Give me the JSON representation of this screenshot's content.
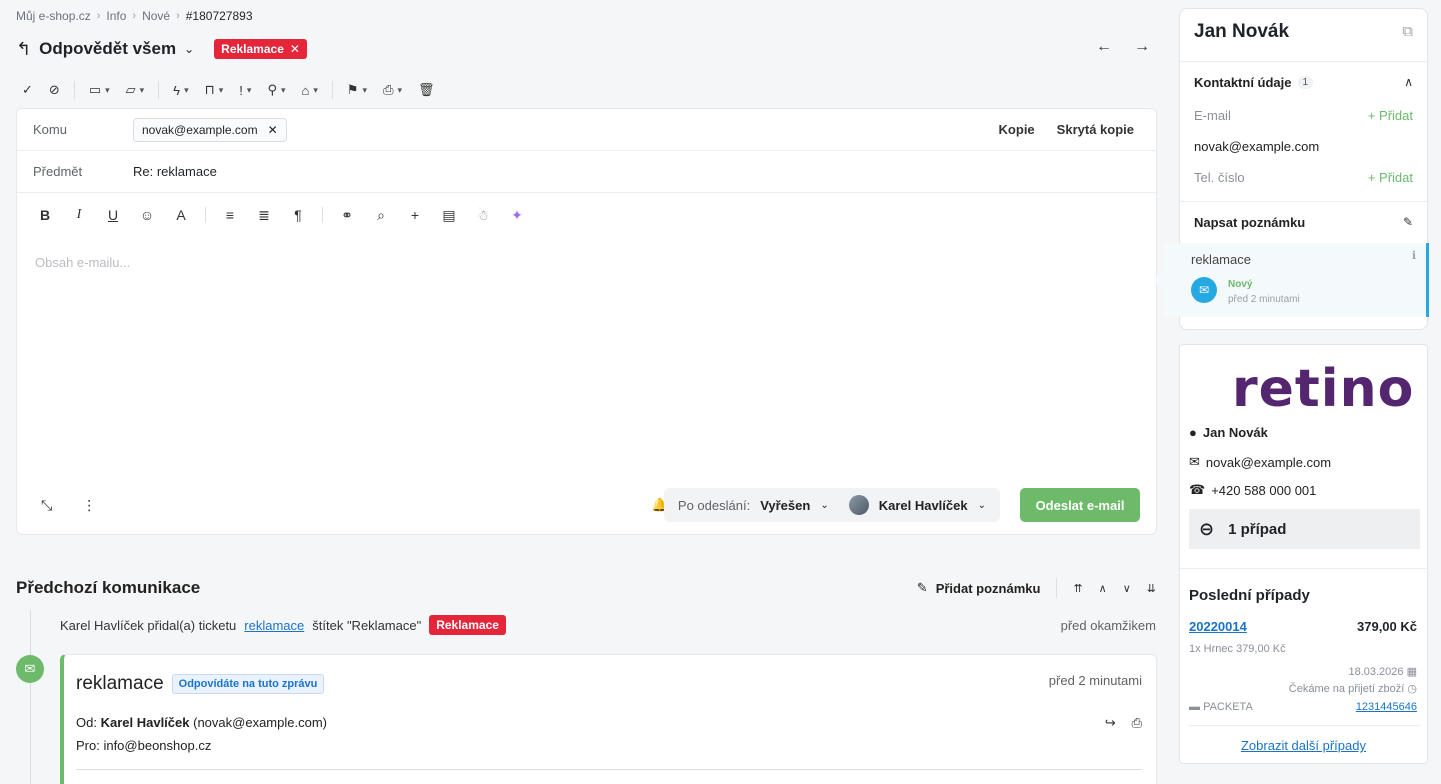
{
  "breadcrumb": [
    "Můj e-shop.cz",
    "Info",
    "Nové",
    "#180727893"
  ],
  "title": {
    "text": "Odpovědět všem",
    "tag": "Reklamace"
  },
  "compose": {
    "to_label": "Komu",
    "to_chip": "novak@example.com",
    "cc": "Kopie",
    "bcc": "Skrytá kopie",
    "subject_label": "Předmět",
    "subject_value": "Re: reklamace",
    "body_placeholder": "Obsah e-mailu...",
    "after_send_label": "Po odeslání:",
    "after_send_status": "Vyřešen",
    "assignee": "Karel Havlíček",
    "send_button": "Odeslat e-mail"
  },
  "previous": {
    "title": "Předchozí komunikace",
    "add_note": "Přidat poznámku",
    "activity": {
      "prefix": "Karel Havlíček přidal(a) ticketu",
      "link": "reklamace",
      "suffix": "štítek \"Reklamace\"",
      "tag": "Reklamace",
      "time": "před okamžikem"
    },
    "message": {
      "subject": "reklamace",
      "badge": "Odpovídáte na tuto zprávu",
      "time": "před 2 minutami",
      "from_label": "Od:",
      "from_name": "Karel Havlíček",
      "from_email": "(novak@example.com)",
      "to": "Pro: info@beonshop.cz"
    }
  },
  "contact": {
    "name": "Jan Novák",
    "section_title": "Kontaktní údaje",
    "section_count": "1",
    "email_label": "E-mail",
    "email_add": "+ Přidat",
    "email_value": "novak@example.com",
    "phone_label": "Tel. číslo",
    "phone_add": "+ Přidat",
    "note_title": "Napsat poznámku",
    "ticket": {
      "name": "reklamace",
      "status": "Nový",
      "ago": "před 2 minutami"
    }
  },
  "retino": {
    "logo": "retino",
    "name": "Jan Novák",
    "email": "novak@example.com",
    "phone": "+420 588 000 001",
    "cases": "1 případ",
    "last_title": "Poslední případy",
    "case_id": "20220014",
    "case_price": "379,00 Kč",
    "case_item": "1x Hrnec 379,00 Kč",
    "case_date": "18.03.2026",
    "case_status": "Čekáme na přijetí zboží",
    "carrier": "PACKETA",
    "tracking": "1231445646",
    "more": "Zobrazit další případy"
  }
}
